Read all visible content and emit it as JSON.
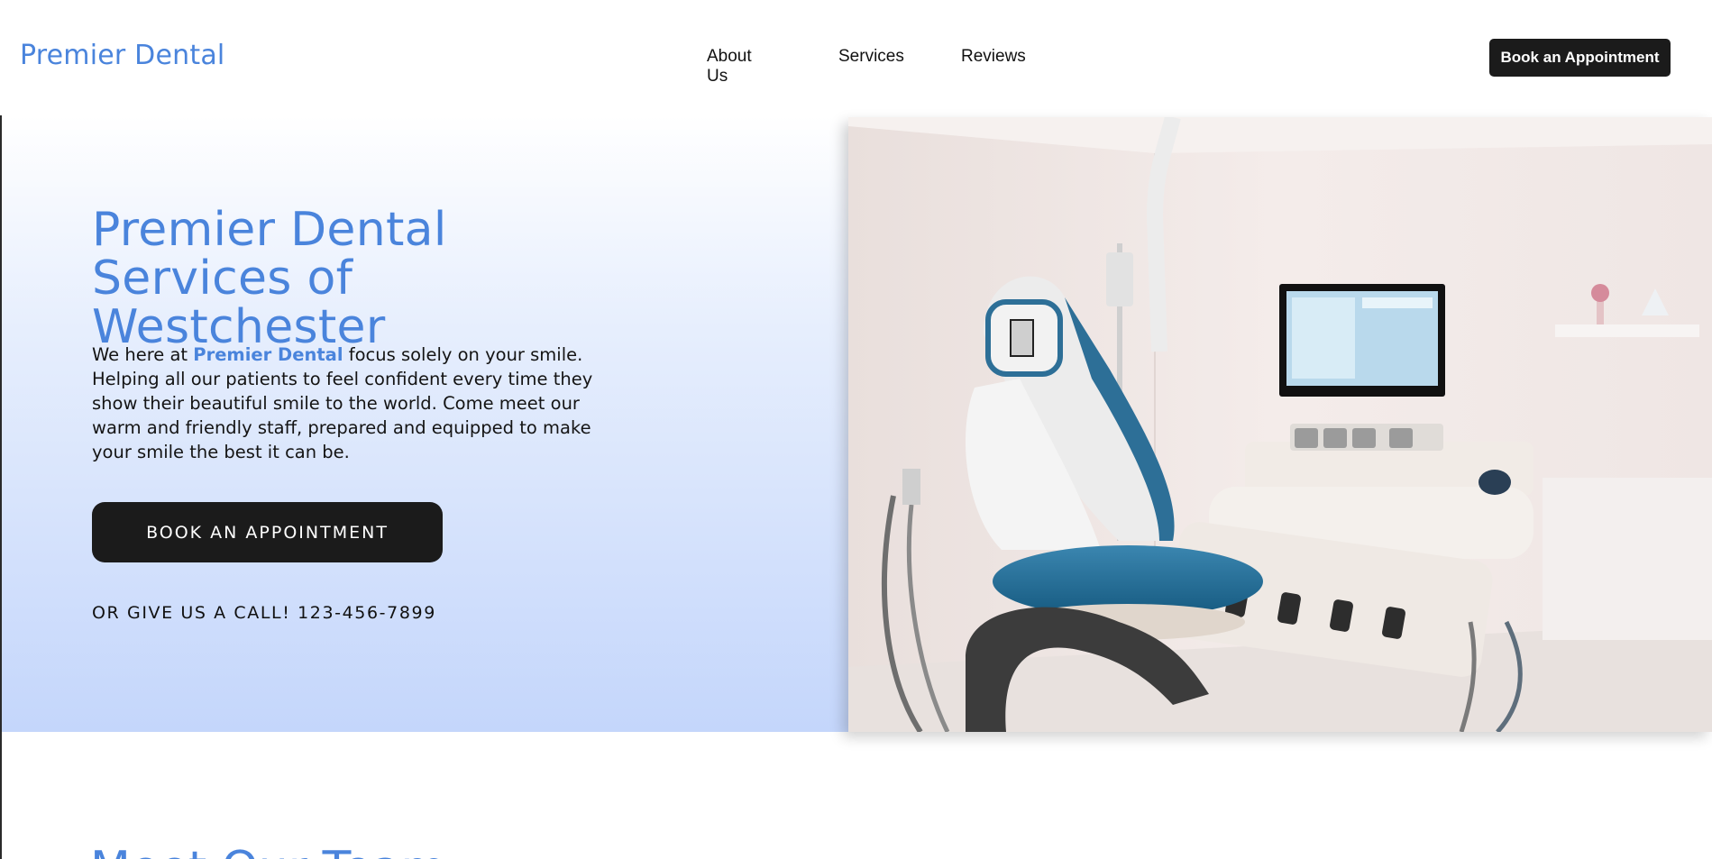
{
  "header": {
    "brand": "Premier Dental",
    "nav": [
      "About Us",
      "Services",
      "Reviews"
    ],
    "cta_label": "Book an Appointment"
  },
  "hero": {
    "title": "Premier Dental Services of Westchester",
    "body_prefix": "We here at ",
    "body_highlight": "Premier Dental",
    "body_suffix": " focus solely on your smile. Helping all our patients to feel confident every time they show their beautiful smile to the world. Come meet our warm and friendly staff, prepared and equipped to make your smile the best it can be.",
    "cta_label": "BOOK AN APPOINTMENT",
    "call_text": "OR GIVE US A CALL! 123-456-7899",
    "image_alt": "dental-office-chair-photo"
  },
  "next_section": {
    "heading_partial": "Meet Our Team"
  },
  "colors": {
    "brand_blue": "#4a84dc",
    "dark_button": "#1b1b1b",
    "gradient_bottom": "#c4d6fb"
  }
}
